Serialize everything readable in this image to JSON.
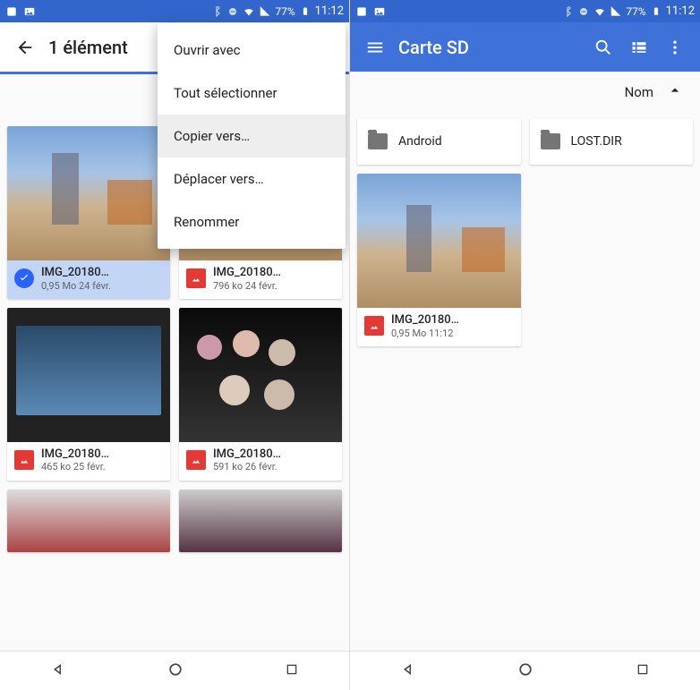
{
  "status": {
    "battery_pct": "77%",
    "time": "11:12"
  },
  "left": {
    "appbar_title": "1 élément",
    "menu": {
      "open_with": "Ouvrir avec",
      "select_all": "Tout sélectionner",
      "copy_to": "Copier vers…",
      "move_to": "Déplacer vers…",
      "rename": "Renommer"
    },
    "files": [
      {
        "name": "IMG_20180…",
        "sub": "0,95 Mo 24 févr.",
        "selected": true
      },
      {
        "name": "IMG_20180…",
        "sub": "796 ko 24 févr.",
        "selected": false
      },
      {
        "name": "IMG_20180…",
        "sub": "465 ko 25 févr.",
        "selected": false
      },
      {
        "name": "IMG_20180…",
        "sub": "591 ko 26 févr.",
        "selected": false
      }
    ]
  },
  "right": {
    "appbar_title": "Carte SD",
    "sort_label": "Nom",
    "folders": [
      {
        "name": "Android"
      },
      {
        "name": "LOST.DIR"
      }
    ],
    "files": [
      {
        "name": "IMG_20180…",
        "sub": "0,95 Mo 11:12"
      }
    ]
  }
}
